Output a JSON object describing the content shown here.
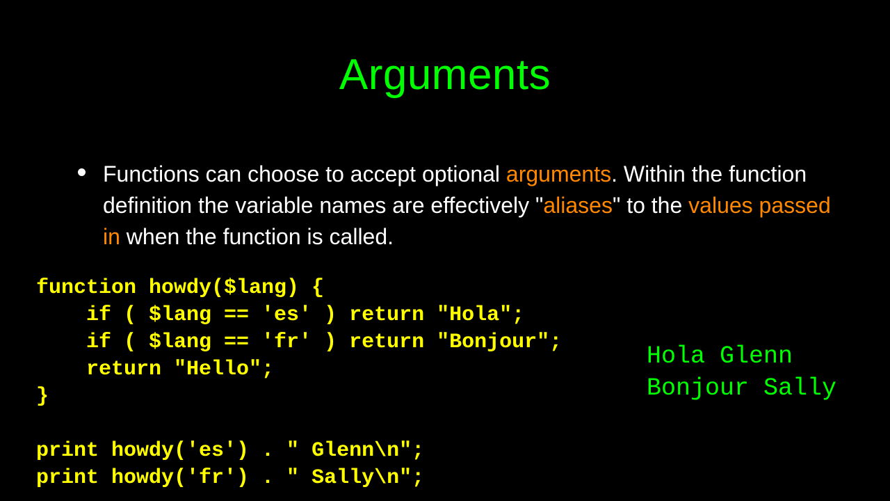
{
  "title": "Arguments",
  "bullet": {
    "t1": "Functions can choose to accept optional ",
    "t2": "arguments",
    "t3": ".  Within the function definition the variable names are effectively \"",
    "t4": "aliases",
    "t5": "\" to the ",
    "t6": "values passed in",
    "t7": " when the function is called."
  },
  "code": "function howdy($lang) {\n    if ( $lang == 'es' ) return \"Hola\";\n    if ( $lang == 'fr' ) return \"Bonjour\";\n    return \"Hello\";\n}\n\nprint howdy('es') . \" Glenn\\n\";\nprint howdy('fr') . \" Sally\\n\";",
  "output": "Hola Glenn\nBonjour Sally"
}
